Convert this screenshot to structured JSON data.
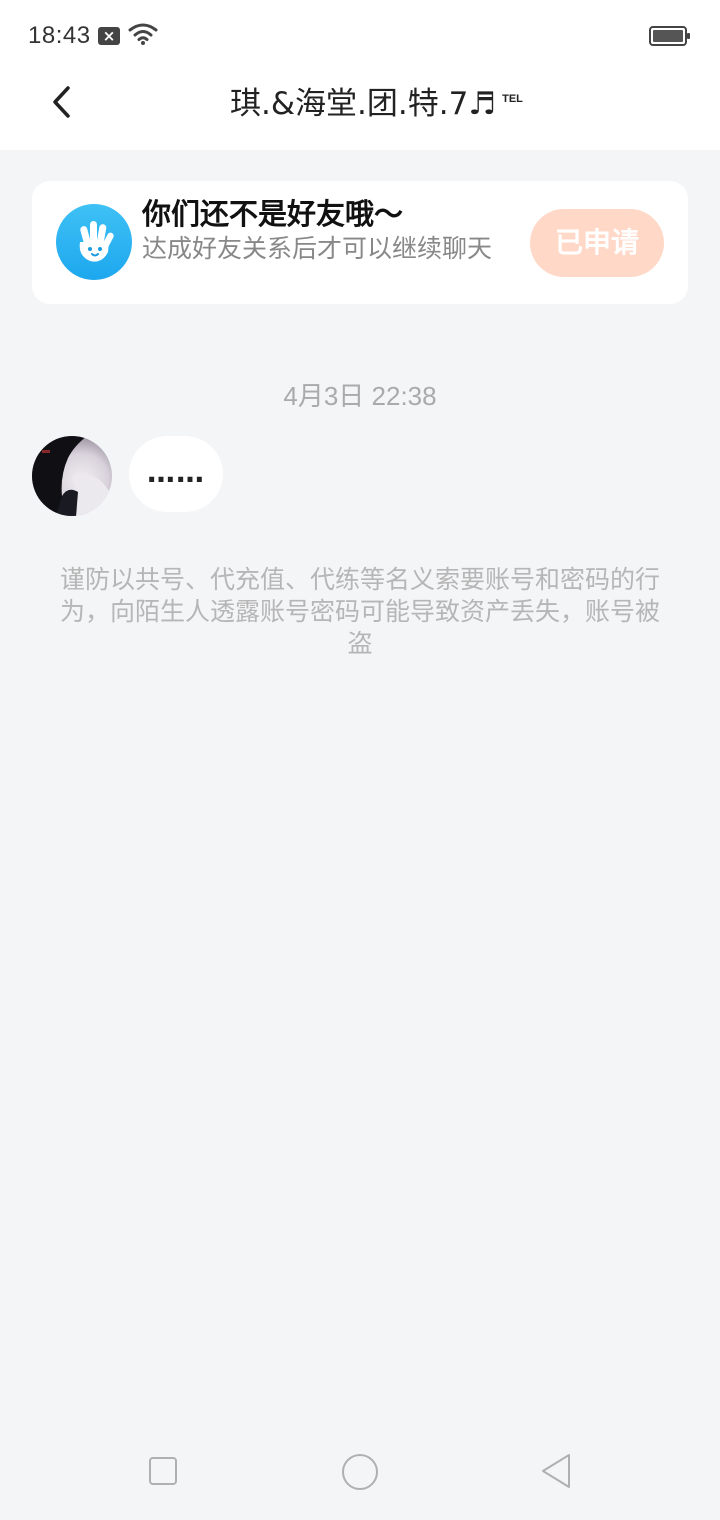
{
  "status_bar": {
    "time": "18:43",
    "icons": [
      "notification-x-icon",
      "wifi-icon",
      "battery-icon"
    ]
  },
  "header": {
    "title": "琪.&海堂.团.特.7♬",
    "title_badge": "TEL",
    "back_icon": "chevron-left-icon"
  },
  "friend_notice": {
    "title": "你们还不是好友哦～",
    "subtitle": "达成好友关系后才可以继续聊天",
    "button_label": "已申请",
    "icon": "hand-wave-icon",
    "colors": {
      "button_bg": "#ffd8c8",
      "icon_bg": "#1da7ee"
    }
  },
  "conversation": {
    "timestamp": "4月3日 22:38",
    "messages": [
      {
        "sender": "other",
        "text": "……"
      }
    ]
  },
  "warning_text": "谨防以共号、代充值、代练等名义索要账号和密码的行为，向陌生人透露账号密码可能导致资产丢失，账号被盗",
  "system_nav": {
    "icons": [
      "recent-apps-icon",
      "home-icon",
      "back-triangle-icon"
    ]
  }
}
